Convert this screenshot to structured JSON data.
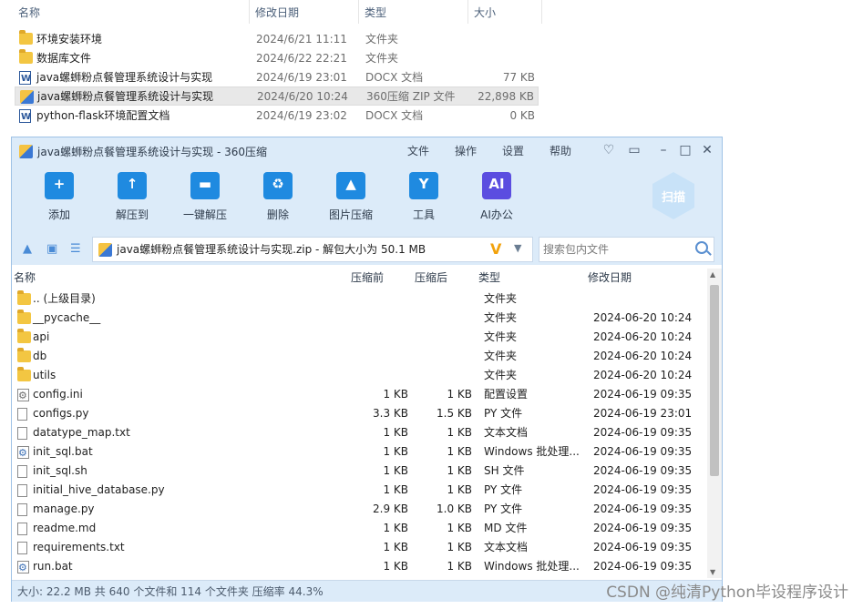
{
  "explorer": {
    "columns": [
      "名称",
      "修改日期",
      "类型",
      "大小"
    ],
    "rows": [
      {
        "name": "环境安装环境",
        "date": "2024/6/21 11:11",
        "type": "文件夹",
        "size": "",
        "icon": "folder-icon"
      },
      {
        "name": "数据库文件",
        "date": "2024/6/22 22:21",
        "type": "文件夹",
        "size": "",
        "icon": "folder-icon"
      },
      {
        "name": "java螺蛳粉点餐管理系统设计与实现",
        "date": "2024/6/19 23:01",
        "type": "DOCX 文档",
        "size": "77 KB",
        "icon": "word-doc-icon"
      },
      {
        "name": "java螺蛳粉点餐管理系统设计与实现",
        "date": "2024/6/20 10:24",
        "type": "360压缩 ZIP 文件",
        "size": "22,898 KB",
        "icon": "zip-icon"
      },
      {
        "name": "python-flask环境配置文档",
        "date": "2024/6/19 23:02",
        "type": "DOCX 文档",
        "size": "0 KB",
        "icon": "word-doc-icon"
      }
    ]
  },
  "archive_window": {
    "title": "java螺蛳粉点餐管理系统设计与实现 - 360压缩",
    "menu": [
      "文件",
      "操作",
      "设置",
      "帮助"
    ],
    "toolbar": [
      {
        "label": "添加",
        "icon": "add-icon",
        "glyph": "+"
      },
      {
        "label": "解压到",
        "icon": "extract-to-icon",
        "glyph": "↑"
      },
      {
        "label": "一键解压",
        "icon": "one-click-extract-icon",
        "glyph": "▬"
      },
      {
        "label": "删除",
        "icon": "delete-icon",
        "glyph": "♻"
      },
      {
        "label": "图片压缩",
        "icon": "image-compress-icon",
        "glyph": "▲"
      },
      {
        "label": "工具",
        "icon": "tools-icon",
        "glyph": "Y"
      },
      {
        "label": "AI办公",
        "icon": "ai-office-icon",
        "glyph": "AI"
      }
    ],
    "scan_label": "扫描",
    "address": "java螺蛳粉点餐管理系统设计与实现.zip - 解包大小为 50.1 MB",
    "search_placeholder": "搜索包内文件",
    "list_columns": {
      "name": "名称",
      "before": "压缩前",
      "after": "压缩后",
      "type": "类型",
      "date": "修改日期"
    },
    "files": [
      {
        "name": ".. (上级目录)",
        "before": "",
        "after": "",
        "type": "文件夹",
        "date": "",
        "icon": "folder-icon"
      },
      {
        "name": "__pycache__",
        "before": "",
        "after": "",
        "type": "文件夹",
        "date": "2024-06-20 10:24",
        "icon": "folder-icon"
      },
      {
        "name": "api",
        "before": "",
        "after": "",
        "type": "文件夹",
        "date": "2024-06-20 10:24",
        "icon": "folder-icon"
      },
      {
        "name": "db",
        "before": "",
        "after": "",
        "type": "文件夹",
        "date": "2024-06-20 10:24",
        "icon": "folder-icon"
      },
      {
        "name": "utils",
        "before": "",
        "after": "",
        "type": "文件夹",
        "date": "2024-06-20 10:24",
        "icon": "folder-icon"
      },
      {
        "name": "config.ini",
        "before": "1 KB",
        "after": "1 KB",
        "type": "配置设置",
        "date": "2024-06-19 09:35",
        "icon": "config-file-icon"
      },
      {
        "name": "configs.py",
        "before": "3.3 KB",
        "after": "1.5 KB",
        "type": "PY 文件",
        "date": "2024-06-19 23:01",
        "icon": "file-icon"
      },
      {
        "name": "datatype_map.txt",
        "before": "1 KB",
        "after": "1 KB",
        "type": "文本文档",
        "date": "2024-06-19 09:35",
        "icon": "file-icon"
      },
      {
        "name": "init_sql.bat",
        "before": "1 KB",
        "after": "1 KB",
        "type": "Windows 批处理...",
        "date": "2024-06-19 09:35",
        "icon": "batch-file-icon"
      },
      {
        "name": "init_sql.sh",
        "before": "1 KB",
        "after": "1 KB",
        "type": "SH 文件",
        "date": "2024-06-19 09:35",
        "icon": "file-icon"
      },
      {
        "name": "initial_hive_database.py",
        "before": "1 KB",
        "after": "1 KB",
        "type": "PY 文件",
        "date": "2024-06-19 09:35",
        "icon": "file-icon"
      },
      {
        "name": "manage.py",
        "before": "2.9 KB",
        "after": "1.0 KB",
        "type": "PY 文件",
        "date": "2024-06-19 09:35",
        "icon": "file-icon"
      },
      {
        "name": "readme.md",
        "before": "1 KB",
        "after": "1 KB",
        "type": "MD 文件",
        "date": "2024-06-19 09:35",
        "icon": "file-icon"
      },
      {
        "name": "requirements.txt",
        "before": "1 KB",
        "after": "1 KB",
        "type": "文本文档",
        "date": "2024-06-19 09:35",
        "icon": "file-icon"
      },
      {
        "name": "run.bat",
        "before": "1 KB",
        "after": "1 KB",
        "type": "Windows 批处理...",
        "date": "2024-06-19 09:35",
        "icon": "batch-file-icon"
      }
    ],
    "status": "大小: 22.2 MB 共 640 个文件和 114 个文件夹 压缩率 44.3%"
  },
  "watermark": "CSDN @纯清Python毕设程序设计",
  "colors": {
    "accent": "#1f8ae0",
    "window_bg": "#dcebf9",
    "border": "#9fc2e6"
  }
}
